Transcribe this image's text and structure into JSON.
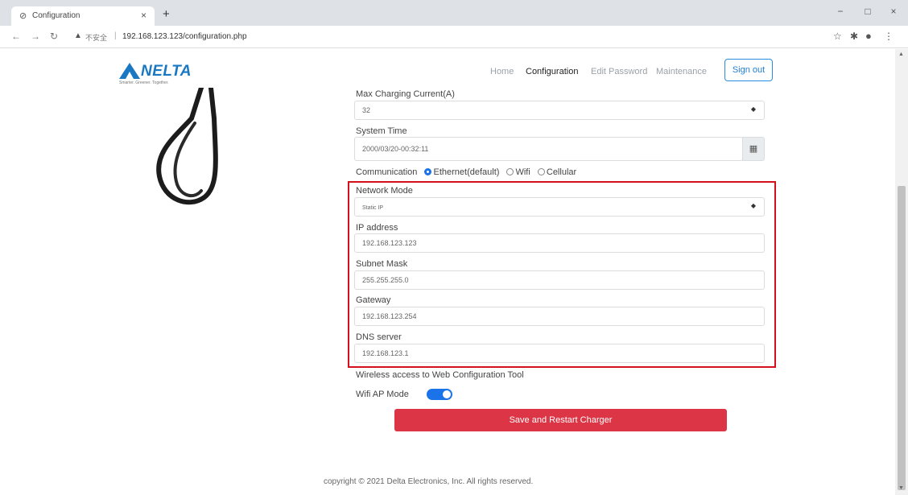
{
  "browser": {
    "tab_title": "Configuration",
    "tab_close": "×",
    "new_tab": "+",
    "not_secure": "不安全",
    "url": "192.168.123.123/configuration.php",
    "window_controls": {
      "minimize": "−",
      "maximize": "□",
      "close": "×"
    }
  },
  "header": {
    "logo_text": "NELTA",
    "logo_tagline": "Smarter. Greener. Together.",
    "nav": [
      {
        "label": "Home",
        "active": false
      },
      {
        "label": "Configuration",
        "active": true
      },
      {
        "label": "Edit Password",
        "active": false
      },
      {
        "label": "Maintenance",
        "active": false
      }
    ],
    "sign_out": "Sign out"
  },
  "form": {
    "max_current": {
      "label": "Max Charging Current(A)",
      "value": "32"
    },
    "system_time": {
      "label": "System Time",
      "value": "2000/03/20-00:32:11"
    },
    "communication": {
      "label": "Communication",
      "options": [
        "Ethernet(default)",
        "Wifi",
        "Cellular"
      ],
      "selected": "Ethernet(default)"
    },
    "network_mode": {
      "label": "Network Mode",
      "value": "Static IP"
    },
    "ip_address": {
      "label": "IP address",
      "value": "192.168.123.123"
    },
    "subnet_mask": {
      "label": "Subnet Mask",
      "value": "255.255.255.0"
    },
    "gateway": {
      "label": "Gateway",
      "value": "192.168.123.254"
    },
    "dns_server": {
      "label": "DNS server",
      "value": "192.168.123.1"
    },
    "wireless_heading": "Wireless access to Web Configuration Tool",
    "wifi_ap_mode": {
      "label": "Wifi AP Mode",
      "enabled": true
    },
    "save_button": "Save and Restart Charger"
  },
  "footer": "copyright © 2021 Delta Electronics, Inc.   All rights reserved.",
  "colors": {
    "highlight_border": "#d4101e",
    "save_button": "#dc3545",
    "accent": "#1a73e8",
    "brand": "#1a78c2"
  }
}
